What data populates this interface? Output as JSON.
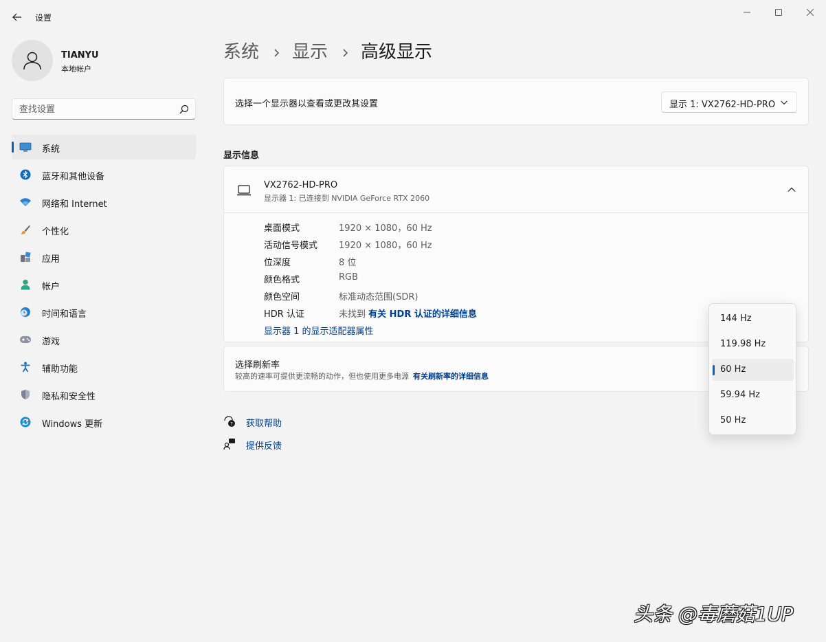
{
  "window": {
    "title": "设置"
  },
  "profile": {
    "name": "TIANYU",
    "account_type": "本地帐户"
  },
  "search": {
    "placeholder": "查找设置"
  },
  "nav": {
    "items": [
      {
        "label": "系统",
        "icon": "display-icon",
        "active": true
      },
      {
        "label": "蓝牙和其他设备",
        "icon": "bluetooth-icon"
      },
      {
        "label": "网络和 Internet",
        "icon": "wifi-icon"
      },
      {
        "label": "个性化",
        "icon": "brush-icon"
      },
      {
        "label": "应用",
        "icon": "apps-icon"
      },
      {
        "label": "帐户",
        "icon": "account-icon"
      },
      {
        "label": "时间和语言",
        "icon": "clock-globe-icon"
      },
      {
        "label": "游戏",
        "icon": "gamepad-icon"
      },
      {
        "label": "辅助功能",
        "icon": "accessibility-icon"
      },
      {
        "label": "隐私和安全性",
        "icon": "shield-icon"
      },
      {
        "label": "Windows 更新",
        "icon": "update-icon"
      }
    ]
  },
  "breadcrumb": {
    "level1": "系统",
    "level2": "显示",
    "level3": "高级显示"
  },
  "display_select": {
    "label": "选择一个显示器以查看或更改其设置",
    "value": "显示 1: VX2762-HD-PRO"
  },
  "display_info": {
    "section_title": "显示信息",
    "monitor_name": "VX2762-HD-PRO",
    "monitor_sub": "显示器 1: 已连接到 NVIDIA GeForce RTX 2060",
    "rows": [
      {
        "key": "桌面模式",
        "value": "1920 × 1080，60 Hz"
      },
      {
        "key": "活动信号模式",
        "value": "1920 × 1080，60 Hz"
      },
      {
        "key": "位深度",
        "value": "8 位"
      },
      {
        "key": "颜色格式",
        "value": "RGB"
      },
      {
        "key": "颜色空间",
        "value": "标准动态范围(SDR)"
      }
    ],
    "hdr_key": "HDR 认证",
    "hdr_value": "未找到",
    "hdr_link": "有关 HDR 认证的详细信息",
    "adapter_link": "显示器 1 的显示适配器属性"
  },
  "refresh": {
    "title": "选择刷新率",
    "description": "较高的速率可提供更流畅的动作，但也使用更多电源",
    "link": "有关刷新率的详细信息",
    "options": [
      "144 Hz",
      "119.98 Hz",
      "60 Hz",
      "59.94 Hz",
      "50 Hz"
    ],
    "selected": "60 Hz"
  },
  "help": {
    "get_help": "获取帮助",
    "feedback": "提供反馈"
  },
  "watermark": "头条 @毒蘑菇1UP",
  "colors": {
    "accent": "#0067c0",
    "link": "#003e92",
    "background": "#f3f3f3",
    "card": "#fbfbfb"
  }
}
